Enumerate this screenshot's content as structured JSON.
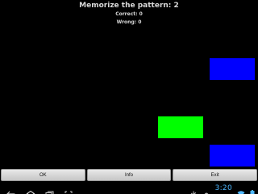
{
  "header": {
    "title": "Memorize the pattern: 2",
    "correct": "Correct: 0",
    "wrong": "Wrong: 0"
  },
  "tiles": [
    {
      "color": "#0000ff"
    },
    {
      "color": "#00ff00"
    },
    {
      "color": "#0000ff"
    }
  ],
  "buttons": {
    "ok": "OK",
    "info": "Info",
    "exit": "Exit"
  },
  "navbar": {
    "icons": [
      "back-icon",
      "home-icon",
      "recent-apps-icon",
      "fullscreen-icon",
      "usb-icon",
      "android-debug-icon",
      "wifi-icon",
      "battery-icon"
    ],
    "time": "3:20"
  }
}
